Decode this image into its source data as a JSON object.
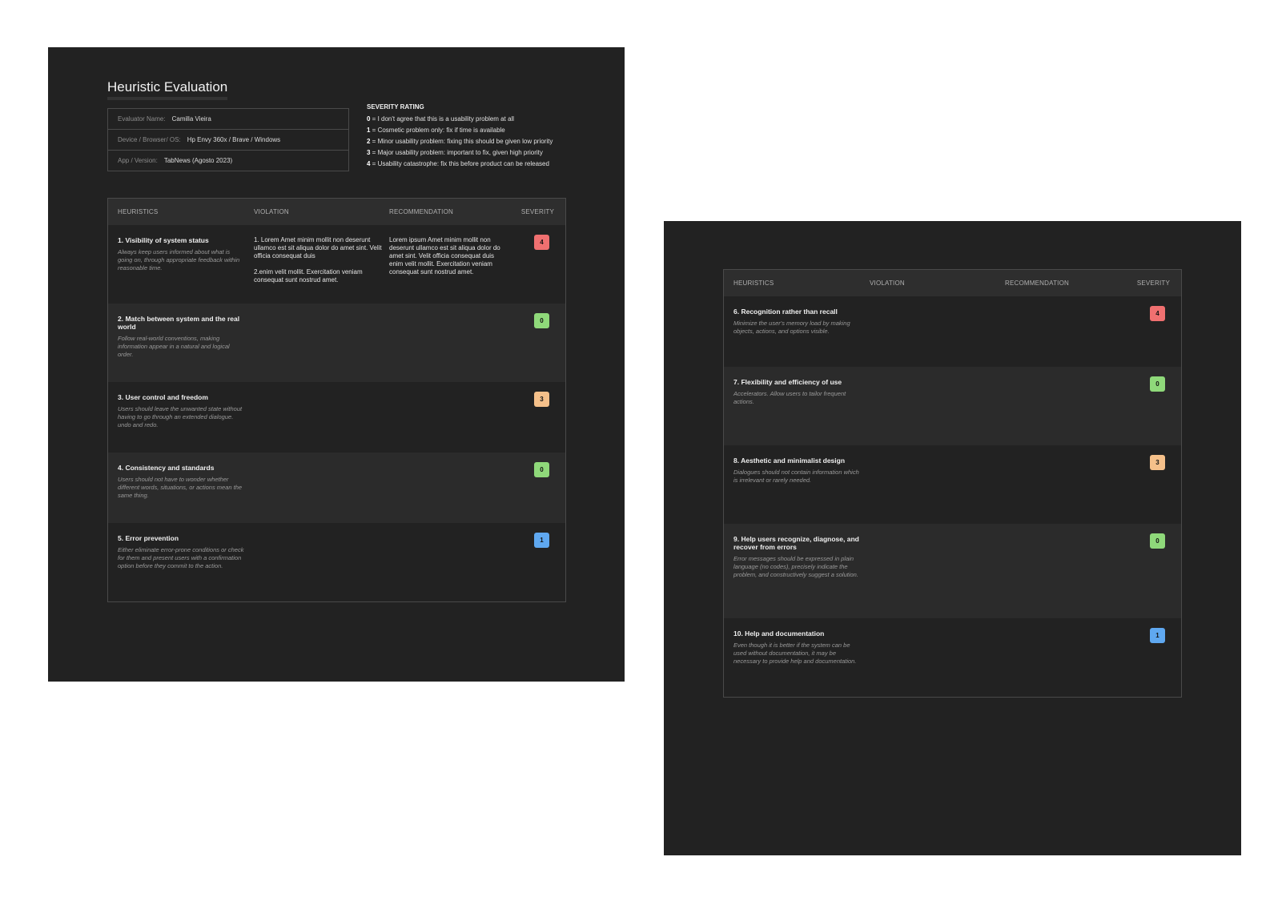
{
  "title": "Heuristic Evaluation",
  "meta": [
    {
      "label": "Evaluator Name:",
      "value": "Camilla Vieira"
    },
    {
      "label": "Device / Browser/ OS:",
      "value": "Hp Envy 360x / Brave / Windows"
    },
    {
      "label": "App / Version:",
      "value": "TabNews (Agosto 2023)"
    }
  ],
  "severity_rating": {
    "heading": "SEVERITY RATING",
    "items": [
      {
        "num": "0",
        "text": " = I don't agree that this is a usability problem at all"
      },
      {
        "num": "1",
        "text": " = Cosmetic problem only: fix if time is available"
      },
      {
        "num": "2",
        "text": " = Minor usability problem: fixing this should be given low priority"
      },
      {
        "num": "3",
        "text": " = Major usability problem: important to fix, given high priority"
      },
      {
        "num": "4",
        "text": " = Usability catastrophe: fix this before product can be released"
      }
    ]
  },
  "columns": {
    "heuristics": "HEURISTICS",
    "violation": "VIOLATION",
    "recommendation": "RECOMMENDATION",
    "severity": "SEVERITY"
  },
  "severity_colors": {
    "0": "#8fd97a",
    "1": "#5fa8f0",
    "3": "#f5c08a",
    "4": "#f07070"
  },
  "rows": [
    {
      "name": "1. Visibility of system status",
      "desc": "Always keep users informed about what is going on, through appropriate feedback within reasonable time.",
      "violation": [
        "1. Lorem Amet minim mollit non deserunt ullamco est sit aliqua dolor do amet sint. Velit officia consequat duis",
        "2.enim velit mollit. Exercitation veniam consequat sunt nostrud amet."
      ],
      "recommendation": "Lorem ipsum Amet minim mollit non deserunt ullamco est sit aliqua dolor do amet sint. Velit officia consequat duis enim velit mollit. Exercitation veniam consequat sunt nostrud amet.",
      "severity": "4"
    },
    {
      "name": "2. Match between system and the real world",
      "desc": "Follow real-world conventions, making information appear in a natural and logical order.",
      "violation": [],
      "recommendation": "",
      "severity": "0"
    },
    {
      "name": "3. User control and freedom",
      "desc": "Users should leave the unwanted state without having to go through an extended dialogue. undo and redo.",
      "violation": [],
      "recommendation": "",
      "severity": "3"
    },
    {
      "name": "4. Consistency and standards",
      "desc": "Users should not have to wonder whether different words, situations, or actions mean the same thing.",
      "violation": [],
      "recommendation": "",
      "severity": "0"
    },
    {
      "name": "5. Error prevention",
      "desc": "Either eliminate error-prone conditions or check for them and present users with a confirmation option before they commit to the action.",
      "violation": [],
      "recommendation": "",
      "severity": "1"
    },
    {
      "name": "6. Recognition rather than recall",
      "desc": "Minimize the user's memory load by making objects, actions, and options visible.",
      "violation": [],
      "recommendation": "",
      "severity": "4"
    },
    {
      "name": "7. Flexibility and efficiency of use",
      "desc": "Accelerators. Allow users to tailor frequent actions.",
      "violation": [],
      "recommendation": "",
      "severity": "0"
    },
    {
      "name": "8. Aesthetic and minimalist design",
      "desc": "Dialogues should not contain information which is irrelevant or rarely needed.",
      "violation": [],
      "recommendation": "",
      "severity": "3"
    },
    {
      "name": "9. Help users recognize, diagnose, and recover from errors",
      "desc": "Error messages should be expressed in plain language (no codes), precisely indicate the problem, and constructively suggest a solution.",
      "violation": [],
      "recommendation": "",
      "severity": "0"
    },
    {
      "name": "10. Help and documentation",
      "desc": "Even though it is better if the system can be used without documentation, it may be necessary to provide help and documentation.",
      "violation": [],
      "recommendation": "",
      "severity": "1"
    }
  ]
}
